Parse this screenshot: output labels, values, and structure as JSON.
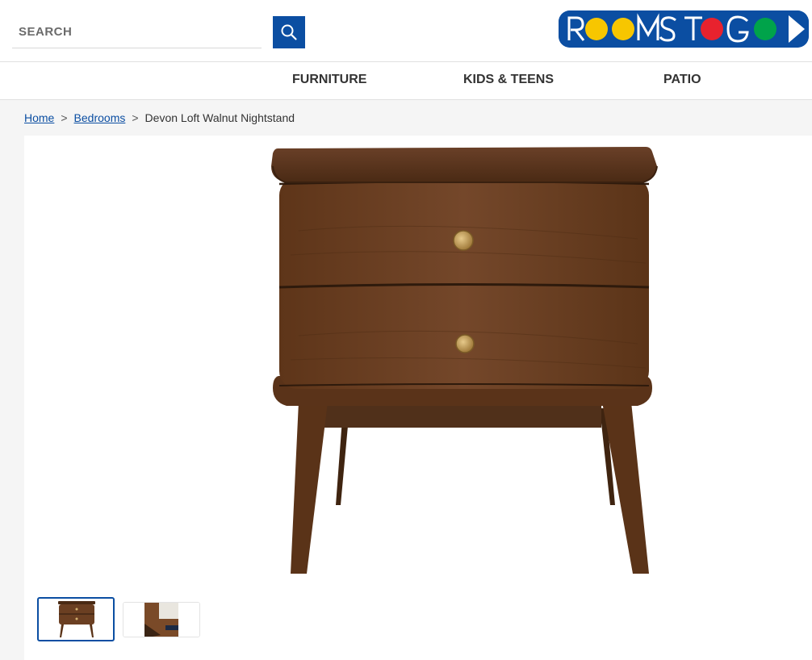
{
  "header": {
    "search": {
      "placeholder": "SEARCH",
      "value": ""
    },
    "search_button_icon": "search-icon",
    "logo": {
      "text": "ROOMS TO GO",
      "brand_color": "#0b4ea2",
      "dot_colors": [
        "#f7c600",
        "#f7c600",
        "#e8222e",
        "#00a34a"
      ]
    }
  },
  "nav": {
    "items": [
      {
        "label": "FURNITURE"
      },
      {
        "label": "KIDS & TEENS"
      },
      {
        "label": "PATIO"
      }
    ]
  },
  "breadcrumb": {
    "items": [
      {
        "label": "Home",
        "link": true
      },
      {
        "label": "Bedrooms",
        "link": true
      },
      {
        "label": "Devon Loft Walnut Nightstand",
        "link": false
      }
    ],
    "separator": ">"
  },
  "product": {
    "main_image_alt": "nightstand-image",
    "thumbnails": [
      {
        "name": "thumbnail-front",
        "selected": true
      },
      {
        "name": "thumbnail-detail",
        "selected": false
      }
    ]
  },
  "colors": {
    "accent": "#0b4ea2",
    "wood": "#6b3f22"
  }
}
